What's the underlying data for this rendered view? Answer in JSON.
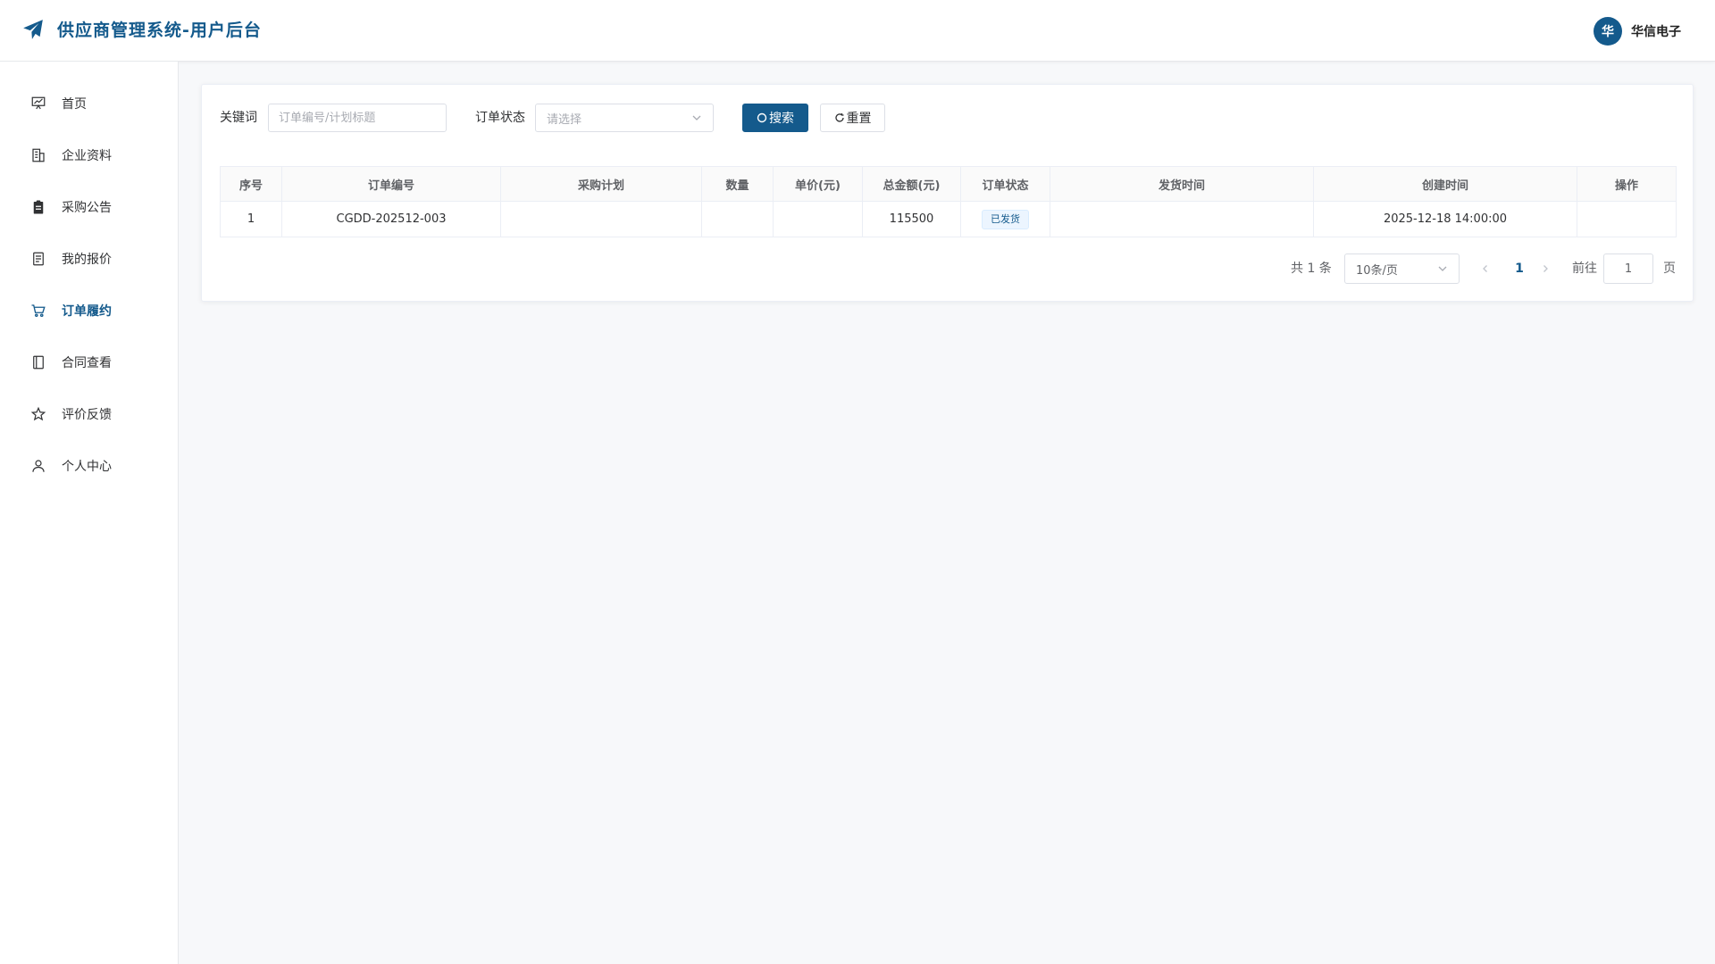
{
  "header": {
    "title": "供应商管理系统-用户后台",
    "user_avatar_text": "华",
    "user_name": "华信电子"
  },
  "sidebar": {
    "items": [
      {
        "label": "首页",
        "icon": "dashboard-icon",
        "active": false
      },
      {
        "label": "企业资料",
        "icon": "building-icon",
        "active": false
      },
      {
        "label": "采购公告",
        "icon": "clipboard-icon",
        "active": false
      },
      {
        "label": "我的报价",
        "icon": "document-icon",
        "active": false
      },
      {
        "label": "订单履约",
        "icon": "cart-icon",
        "active": true
      },
      {
        "label": "合同查看",
        "icon": "notebook-icon",
        "active": false
      },
      {
        "label": "评价反馈",
        "icon": "star-icon",
        "active": false
      },
      {
        "label": "个人中心",
        "icon": "user-icon",
        "active": false
      }
    ]
  },
  "filters": {
    "keyword_label": "关键词",
    "keyword_placeholder": "订单编号/计划标题",
    "keyword_value": "",
    "status_label": "订单状态",
    "status_placeholder": "请选择",
    "search_label": "搜索",
    "reset_label": "重置"
  },
  "table": {
    "columns": [
      "序号",
      "订单编号",
      "采购计划",
      "数量",
      "单价(元)",
      "总金额(元)",
      "订单状态",
      "发货时间",
      "创建时间",
      "操作"
    ],
    "rows": [
      {
        "index": "1",
        "order_no": "CGDD-202512-003",
        "plan": "",
        "quantity": "",
        "unit_price": "",
        "total": "115500",
        "status": "已发货",
        "ship_time": "",
        "created_at": "2025-12-18 14:00:00",
        "actions": ""
      }
    ]
  },
  "pagination": {
    "total_text": "共 1 条",
    "page_size": "10条/页",
    "current_page": "1",
    "goto_label": "前往",
    "goto_value": "1",
    "page_suffix": "页"
  },
  "colors": {
    "primary": "#145a8c",
    "background": "#f7f8fa"
  }
}
